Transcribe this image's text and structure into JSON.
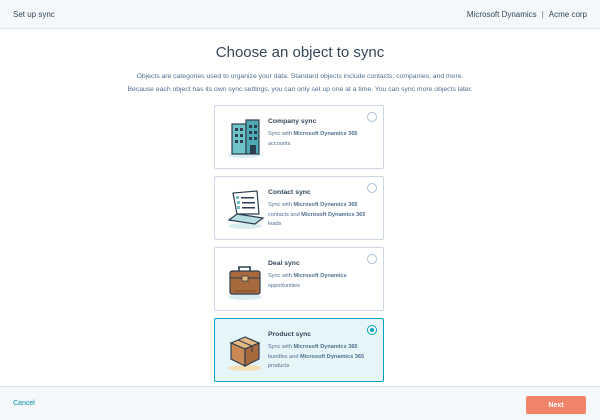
{
  "header": {
    "title": "Set up sync",
    "app_name": "Microsoft Dynamics",
    "separator": "|",
    "account": "Acme corp"
  },
  "main": {
    "title": "Choose an object to sync",
    "description_line1": "Objects are categories used to organize your data. Standard objects include contacts, companies, and more.",
    "description_line2": "Because each object has its own sync settings, you can only set up one at a time. You can sync more objects later."
  },
  "options": [
    {
      "title": "Company sync",
      "desc_pre": "Sync with ",
      "bold1": "Microsoft Dynamics 365",
      "desc_mid": "",
      "bold2": "",
      "desc_post": " accounts",
      "icon": "building-icon",
      "selected": false
    },
    {
      "title": "Contact sync",
      "desc_pre": "Sync with ",
      "bold1": "Microsoft Dynamics 365",
      "desc_mid": " contacts and ",
      "bold2": "Microsoft Dynamics 365",
      "desc_post": " leads",
      "icon": "laptop-list-icon",
      "selected": false
    },
    {
      "title": "Deal sync",
      "desc_pre": "Sync with ",
      "bold1": "Microsoft Dynamics",
      "desc_mid": "",
      "bold2": "",
      "desc_post": " opportunities",
      "icon": "briefcase-icon",
      "selected": false
    },
    {
      "title": "Product sync",
      "desc_pre": "Sync with ",
      "bold1": "Microsoft Dynamics 365",
      "desc_mid": " bundles and ",
      "bold2": "Microsoft Dynamics 365",
      "desc_post": " products",
      "icon": "box-icon",
      "selected": true
    }
  ],
  "footer": {
    "cancel_label": "Cancel",
    "next_label": "Next"
  },
  "colors": {
    "accent": "#00a4bd",
    "next_button": "#f2836b",
    "link": "#0091ae"
  }
}
